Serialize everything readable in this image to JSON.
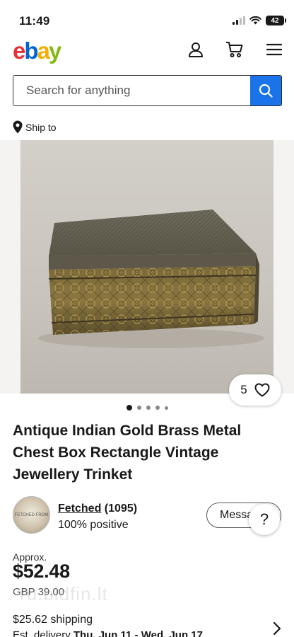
{
  "status_bar": {
    "time": "11:49",
    "battery": "42"
  },
  "header": {
    "logo_letters": [
      "e",
      "b",
      "a",
      "y"
    ],
    "logo_colors": [
      "#e53238",
      "#0064d2",
      "#f5af02",
      "#86b817"
    ],
    "icons": [
      "account-icon",
      "cart-icon",
      "menu-icon"
    ]
  },
  "search": {
    "placeholder": "Search for anything"
  },
  "ship_to": {
    "label": "Ship to"
  },
  "gallery": {
    "watch_count": "5",
    "image_count": 5,
    "active_index": 0
  },
  "listing": {
    "title": "Antique Indian Gold Brass Metal Chest Box Rectangle Vintage Jewellery Trinket"
  },
  "seller": {
    "name": "Fetched",
    "feedback_count": "(1095)",
    "positive": "100% positive",
    "avatar_text": "FETCHED FROM",
    "message_label": "Message"
  },
  "price": {
    "approx_label": "Approx.",
    "converted": "$52.48",
    "original": "GBP 39.00",
    "watermark": "ru.bidfin.lt"
  },
  "shipping": {
    "cost": "$25.62 shipping",
    "delivery_label": "Est. delivery",
    "delivery_range": "Thu, Jun 11 - Wed, Jun 17"
  },
  "colors": {
    "accent_blue": "#1a73e8",
    "text": "#191919"
  }
}
